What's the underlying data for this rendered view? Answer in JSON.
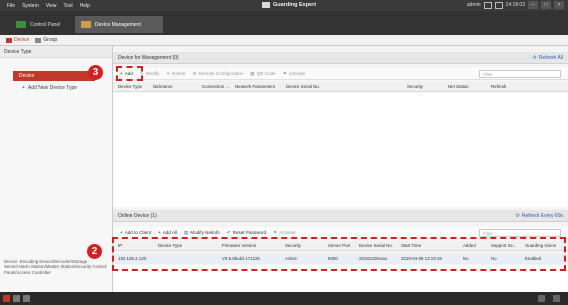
{
  "menubar": {
    "items": [
      "File",
      "System",
      "View",
      "Tool",
      "Help"
    ],
    "app_title": "Guarding Expert",
    "user": "admin",
    "time": "14:18:03"
  },
  "tabs": [
    {
      "label": "Control Panel"
    },
    {
      "label": "Device Management"
    }
  ],
  "subtabs": [
    {
      "label": "Device"
    },
    {
      "label": "Group"
    }
  ],
  "left": {
    "header": "Device Type",
    "selected_item": "Device",
    "add_item": "Add New Device Type",
    "description": "Device: Encoding Device/Decoder/Storage Server/Alarm Station/Master Station/Security Control Panel/Access Controller"
  },
  "managed": {
    "title": "Device for Management (0)",
    "refresh": "Refresh All",
    "buttons": [
      "Add",
      "Modify",
      "Delete",
      "Remote Configuration",
      "QR Code",
      "Activate"
    ],
    "filter_placeholder": "Filter",
    "columns": [
      "Device Type",
      "Nickname",
      "Connection ...",
      "Network Parameters",
      "Device Serial No.",
      "Security",
      "Net Status",
      "Refresh"
    ]
  },
  "online": {
    "title": "Online Device (1)",
    "refresh": "Refresh Every 60s",
    "buttons": [
      "Add to Client",
      "Add All",
      "Modify Netinfo",
      "Reset Password",
      "Activate"
    ],
    "filter_placeholder": "Filter",
    "columns": [
      "IP",
      "Device Type",
      "Firmware Version",
      "Security",
      "Server Port",
      "Device Serial No.",
      "Start Time",
      "Added",
      "Support Se...",
      "Guarding Vision"
    ],
    "row": [
      "192.168.2.120",
      "",
      "V3.5.9build 171225",
      "Active",
      "8000",
      "20181029xxxx",
      "2018-04-08 13:19:18",
      "No",
      "No",
      "Enabled"
    ]
  },
  "annotations": {
    "badge_add": "3",
    "badge_row": "2"
  },
  "colors": {
    "accent": "#c0392b",
    "annotation": "#d62020",
    "link": "#2a5db0"
  }
}
